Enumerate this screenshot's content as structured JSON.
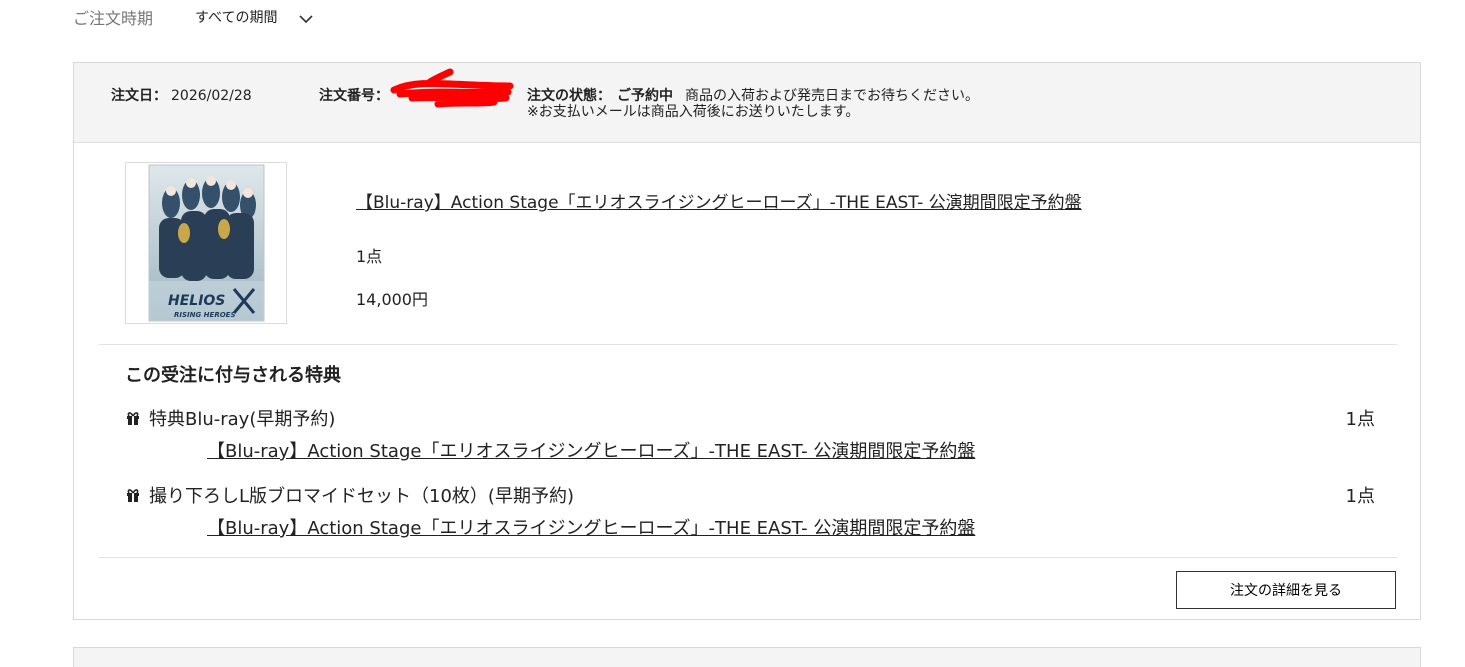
{
  "filter": {
    "label": "ご注文時期",
    "selected": "すべての期間"
  },
  "order": {
    "date_label": "注文日：",
    "date_value": "2026/02/28",
    "number_label": "注文番号：",
    "status_label": "注文の状態：",
    "status_value": "ご予約中",
    "status_message": "商品の入荷および発売日までお待ちください。",
    "status_note": "※お支払いメールは商品入荷後にお送りいたします。",
    "product": {
      "title": "【Blu-ray】Action Stage「エリオスライジングヒーローズ」-THE EAST- 公演期間限定予約盤",
      "quantity": "1点",
      "price": "14,000円"
    },
    "bonus_heading": "この受注に付与される特典",
    "bonuses": [
      {
        "name": "特典Blu-ray(早期予約)",
        "quantity": "1点",
        "link": "【Blu-ray】Action Stage「エリオスライジングヒーローズ」-THE EAST- 公演期間限定予約盤"
      },
      {
        "name": "撮り下ろしL版ブロマイドセット（10枚）(早期予約)",
        "quantity": "1点",
        "link": "【Blu-ray】Action Stage「エリオスライジングヒーローズ」-THE EAST- 公演期間限定予約盤"
      }
    ],
    "detail_button": "注文の詳細を見る"
  },
  "colors": {
    "header_bg": "#f4f4f4",
    "border": "#d8d8d8",
    "redaction": "#ff0000"
  },
  "icons": {
    "filter_dropdown": "chevron-down-icon",
    "bonus": "gift-icon"
  }
}
